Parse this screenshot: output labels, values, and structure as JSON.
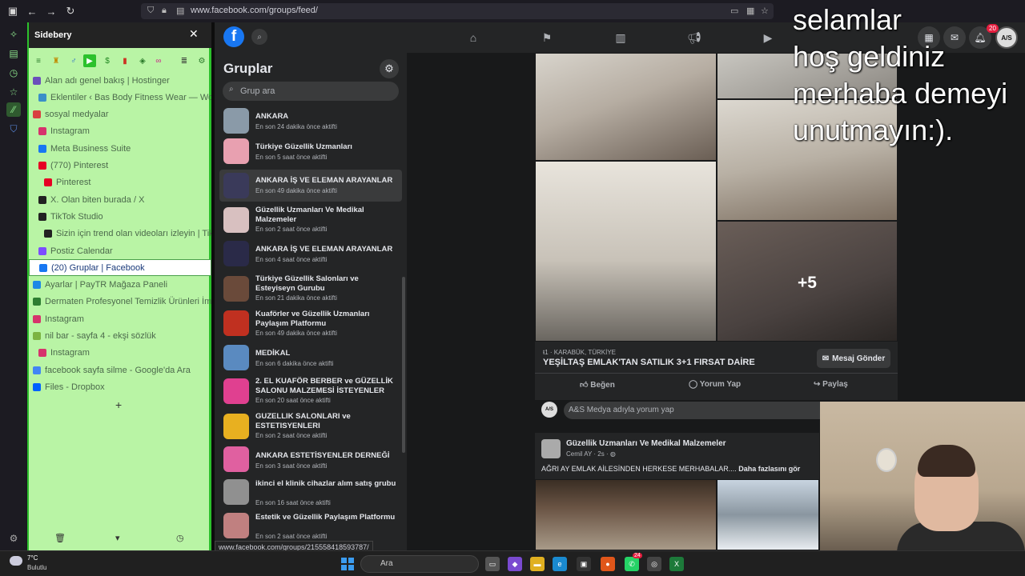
{
  "browser": {
    "url": "www.facebook.com/groups/feed/"
  },
  "sidebery": {
    "title": "Sidebery",
    "tabs": [
      {
        "label": "Alan adı genel bakış | Hostinger",
        "indent": 0,
        "color": "#6b4fbb"
      },
      {
        "label": "Eklentiler ‹ Bas Body Fitness Wear — WordPress",
        "indent": 1,
        "color": "#3a8fc8"
      },
      {
        "label": "sosyal medyalar",
        "indent": 0,
        "color": "#d94040"
      },
      {
        "label": "Instagram",
        "indent": 1,
        "color": "#d6336c"
      },
      {
        "label": "Meta Business Suite",
        "indent": 1,
        "color": "#1877f2"
      },
      {
        "label": "(770) Pinterest",
        "indent": 1,
        "color": "#e60023"
      },
      {
        "label": "Pinterest",
        "indent": 2,
        "color": "#e60023"
      },
      {
        "label": "X. Olan biten burada / X",
        "indent": 1,
        "color": "#222222"
      },
      {
        "label": "TikTok Studio",
        "indent": 1,
        "color": "#222222"
      },
      {
        "label": "Sizin için trend olan videoları izleyin | TikTok",
        "indent": 2,
        "color": "#222222"
      },
      {
        "label": "Postiz Calendar",
        "indent": 1,
        "color": "#7c4dff"
      },
      {
        "label": "(20) Gruplar | Facebook",
        "indent": 1,
        "color": "#1877f2",
        "active": true
      },
      {
        "label": "Ayarlar | PayTR Mağaza Paneli",
        "indent": 0,
        "color": "#1e88e5"
      },
      {
        "label": "Dermaten Profesyonel Temizlik Ürünleri İmalatı",
        "indent": 0,
        "color": "#2e7d32"
      },
      {
        "label": "Instagram",
        "indent": 0,
        "color": "#d6336c"
      },
      {
        "label": "nil bar - sayfa 4 - ekşi sözlük",
        "indent": 0,
        "color": "#7cb342"
      },
      {
        "label": "Instagram",
        "indent": 1,
        "color": "#d6336c"
      },
      {
        "label": "facebook sayfa silme - Google'da Ara",
        "indent": 0,
        "color": "#4285f4"
      },
      {
        "label": "Files - Dropbox",
        "indent": 0,
        "color": "#0061ff"
      }
    ],
    "add_label": "+"
  },
  "groups_panel": {
    "title": "Gruplar",
    "search_placeholder": "Grup ara",
    "items": [
      {
        "name": "ANKARA",
        "meta": "En son 24 dakika önce aktifti",
        "color": "#8a9aa8"
      },
      {
        "name": "Türkiye Güzellik Uzmanları",
        "meta": "En son 5 saat önce aktifti",
        "color": "#e8a0b0"
      },
      {
        "name": "ANKARA İŞ VE ELEMAN ARAYANLAR",
        "meta": "En son 49 dakika önce aktifti",
        "color": "#3a3a5a"
      },
      {
        "name": "Güzellik Uzmanları Ve Medikal Malzemeler",
        "meta": "En son 2 saat önce aktifti",
        "color": "#d8c0c0"
      },
      {
        "name": "ANKARA İŞ VE ELEMAN ARAYANLAR",
        "meta": "En son 4 saat önce aktifti",
        "color": "#2a2a48"
      },
      {
        "name": "Türkiye Güzellik Salonları ve Esteyiseyn Gurubu",
        "meta": "En son 21 dakika önce aktifti",
        "color": "#6a4a3a"
      },
      {
        "name": "Kuaförler ve Güzellik Uzmanları Paylaşım Platformu",
        "meta": "En son 49 dakika önce aktifti",
        "color": "#c03020"
      },
      {
        "name": "MEDİKAL",
        "meta": "En son 6 dakika önce aktifti",
        "color": "#5a8ac0"
      },
      {
        "name": "2. EL KUAFÖR BERBER ve GÜZELLİK SALONU MALZEMESİ İSTEYENLER",
        "meta": "En son 20 saat önce aktifti",
        "color": "#e04090"
      },
      {
        "name": "GUZELLIK SALONLARI ve ESTETISYENLERI",
        "meta": "En son 2 saat önce aktifti",
        "color": "#e8b020"
      },
      {
        "name": "ANKARA ESTETİSYENLER DERNEĞİ",
        "meta": "En son 3 saat önce aktifti",
        "color": "#e060a0"
      },
      {
        "name": "ikinci el klinik cihazlar alım satış grubu",
        "meta": "En son 16 saat önce aktifti",
        "color": "#909090"
      },
      {
        "name": "Estetik ve Güzellik Paylaşım Platformu",
        "meta": "En son 2 saat önce aktifti",
        "color": "#c08080"
      }
    ]
  },
  "topbar": {
    "notifications_count": "20",
    "avatar_label": "A/S"
  },
  "post1": {
    "more_photos": "+5",
    "location": "ŧ1 · KARABÜK, TÜRKİYE",
    "title": "YEŞİLTAŞ EMLAK'TAN SATILIK 3+1 FIRSAT DAİRE",
    "message_button": "Mesaj Gönder",
    "like": "Beğen",
    "comment": "Yorum Yap",
    "share": "Paylaş"
  },
  "comment_box": {
    "avatar_label": "A/S",
    "placeholder": "A&S Medya adıyla yorum yap"
  },
  "post2": {
    "group": "Güzellik Uzmanları Ve Medikal Malzemeler",
    "author": "Cemil AY · 2s · ",
    "text": "AĞRI AY EMLAK AİLESİNDEN HERKESE MERHABALAR.... ",
    "more": "Daha fazlasını gör"
  },
  "overlay": {
    "line1": "selamlar",
    "line2": "hoş geldiniz",
    "line3": "merhaba demeyi",
    "line4": "unutmayın:)."
  },
  "status_url": "www.facebook.com/groups/215558418593787/",
  "taskbar": {
    "temp": "7°C",
    "weather": "Bulutlu",
    "search": "Ara",
    "badge_whatsapp": "24"
  }
}
